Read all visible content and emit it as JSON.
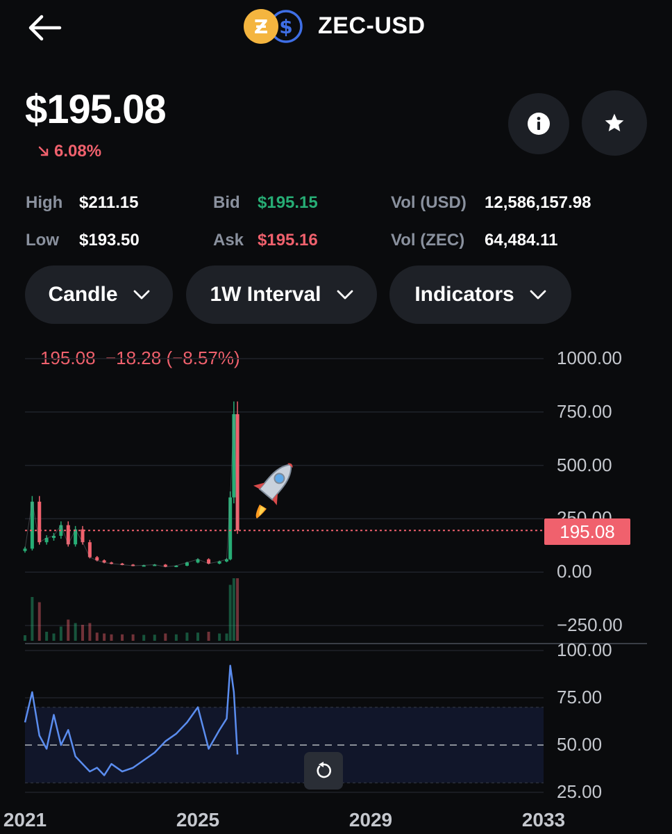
{
  "header": {
    "back_icon": "arrow-left-icon",
    "pair": "ZEC-USD",
    "logos": [
      "zcash-coin-icon",
      "usd-coin-icon"
    ]
  },
  "summary": {
    "price": "$195.08",
    "change": "6.08%",
    "change_direction": "down",
    "info_icon": "info-icon",
    "star_icon": "star-icon"
  },
  "stats": {
    "high_label": "High",
    "high_value": "$211.15",
    "low_label": "Low",
    "low_value": "$193.50",
    "bid_label": "Bid",
    "bid_value": "$195.15",
    "ask_label": "Ask",
    "ask_value": "$195.16",
    "vol_usd_label": "Vol (USD)",
    "vol_usd_value": "12,586,157.98",
    "vol_zec_label": "Vol (ZEC)",
    "vol_zec_value": "64,484.11"
  },
  "controls": {
    "chart_type": "Candle",
    "interval": "1W Interval",
    "indicators": "Indicators"
  },
  "chart": {
    "ohlc_summary": "195.08  −18.28 (−8.57%)",
    "last_price": "195.08",
    "price_axis": [
      "1000.00",
      "750.00",
      "500.00",
      "250.00",
      "0.00",
      "−250.00"
    ],
    "rsi_axis": [
      "100.00",
      "75.00",
      "50.00",
      "25.00"
    ],
    "time_axis": [
      "2021",
      "2025",
      "2029",
      "2033"
    ],
    "reset_icon": "reset-zoom-icon",
    "annotation": "rocket-emoji",
    "colors": {
      "up": "#27ad75",
      "down": "#f0616d",
      "rsi": "#5b8def",
      "last_price": "#f0616d"
    }
  },
  "chart_data": {
    "type": "candlestick",
    "price": {
      "ylim": [
        -250,
        1000
      ],
      "x": [
        "2021-01",
        "2021-03",
        "2021-05",
        "2021-07",
        "2021-09",
        "2021-11",
        "2022-01",
        "2022-03",
        "2022-05",
        "2022-07",
        "2022-09",
        "2022-11",
        "2023-01",
        "2023-04",
        "2023-07",
        "2023-10",
        "2024-01",
        "2024-04",
        "2024-07",
        "2024-10",
        "2025-01",
        "2025-04",
        "2025-07",
        "2025-09",
        "2025-10",
        "2025-11",
        "2025-12"
      ],
      "close": [
        110,
        330,
        140,
        160,
        170,
        220,
        130,
        200,
        140,
        70,
        55,
        45,
        40,
        35,
        30,
        32,
        35,
        25,
        30,
        45,
        60,
        40,
        50,
        60,
        350,
        740,
        195
      ]
    },
    "rsi": {
      "ylim": [
        25,
        100
      ],
      "reference": 50,
      "values": [
        62,
        78,
        55,
        48,
        66,
        50,
        58,
        44,
        40,
        36,
        38,
        34,
        40,
        36,
        38,
        42,
        46,
        52,
        56,
        62,
        70,
        48,
        58,
        64,
        92,
        78,
        45
      ]
    }
  }
}
